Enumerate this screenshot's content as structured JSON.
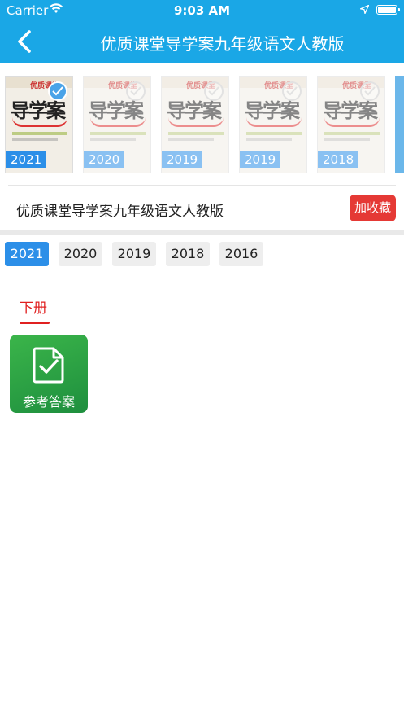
{
  "status_bar": {
    "carrier": "Carrier",
    "time": "9:03 AM",
    "icons": [
      "wifi-icon",
      "location-arrow-icon",
      "battery-icon"
    ]
  },
  "nav": {
    "title": "优质课堂导学案九年级语文人教版",
    "back_icon": "chevron-left-icon"
  },
  "covers": [
    {
      "year": "2021",
      "selected": true,
      "brand": "优质课堂",
      "title": "导学案"
    },
    {
      "year": "2020",
      "selected": false,
      "brand": "优质课堂",
      "title": "导学案"
    },
    {
      "year": "2019",
      "selected": false,
      "brand": "优质课堂",
      "title": "导学案"
    },
    {
      "year": "2019",
      "selected": false,
      "brand": "优质课堂",
      "title": "导学案"
    },
    {
      "year": "2018",
      "selected": false,
      "brand": "优质课堂",
      "title": "导学案"
    }
  ],
  "book": {
    "name": "优质课堂导学案九年级语文人教版",
    "favorite_label": "加收藏"
  },
  "years": {
    "items": [
      "2021",
      "2020",
      "2019",
      "2018",
      "2016"
    ],
    "selected": "2021"
  },
  "volume_tab": "下册",
  "answer_button": {
    "label": "参考答案",
    "icon": "document-check-icon"
  },
  "colors": {
    "header": "#1aa7e6",
    "accent_blue": "#2c8fe8",
    "favorite_red": "#e53935",
    "tab_red": "#e02020",
    "answer_green": "#2aa84a"
  }
}
